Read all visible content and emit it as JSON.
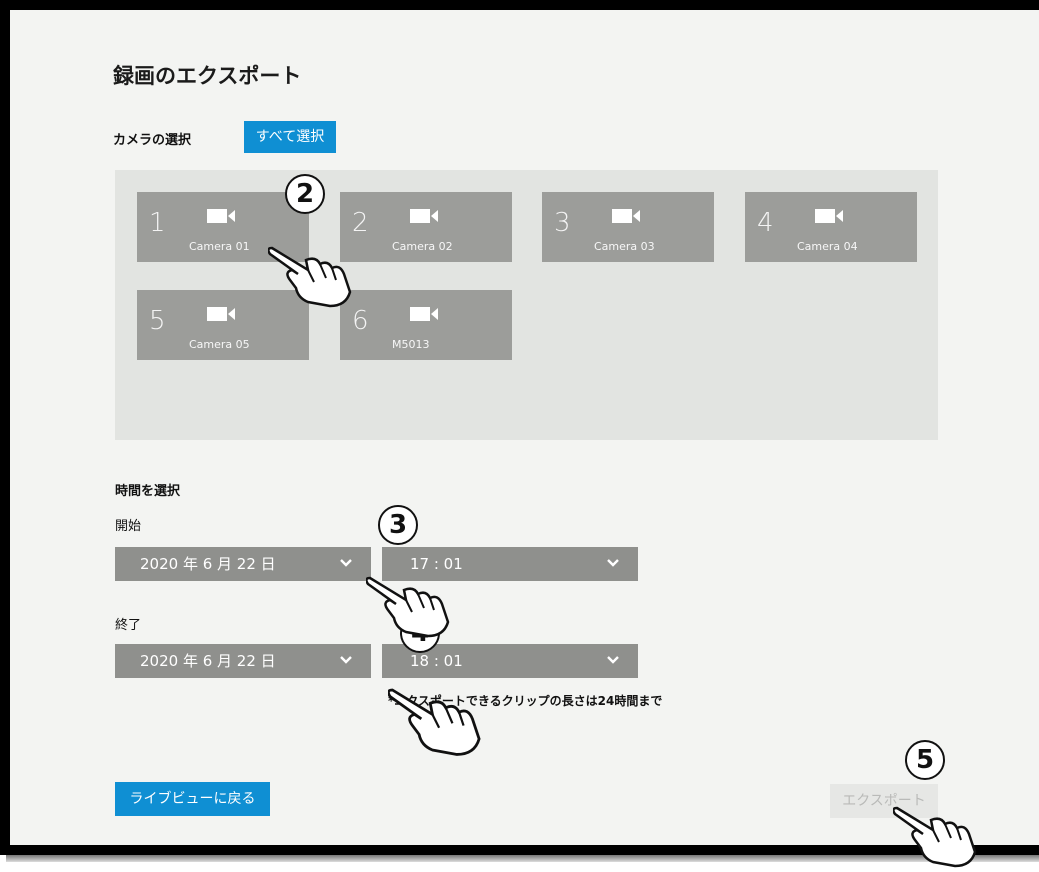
{
  "page": {
    "title": "録画のエクスポート",
    "camera_select_label": "カメラの選択",
    "select_all_label": "すべて選択",
    "time_select_label": "時間を選択",
    "start_label": "開始",
    "end_label": "終了",
    "note": "*エクスポートできるクリップの長さは24時間まで",
    "back_button_label": "ライブビューに戻る",
    "export_button_label": "エクスポート"
  },
  "cameras": [
    {
      "number": "1",
      "name": "Camera 01",
      "icon": "video-camera-icon"
    },
    {
      "number": "2",
      "name": "Camera 02",
      "icon": "video-camera-icon"
    },
    {
      "number": "3",
      "name": "Camera 03",
      "icon": "video-camera-icon"
    },
    {
      "number": "4",
      "name": "Camera 04",
      "icon": "video-camera-icon"
    },
    {
      "number": "5",
      "name": "Camera 05",
      "icon": "video-camera-icon"
    },
    {
      "number": "6",
      "name": "M5013",
      "icon": "video-camera-icon"
    }
  ],
  "start": {
    "date": "2020 年 6 月 22 日",
    "time": "17 : 01"
  },
  "end": {
    "date": "2020 年 6 月 22 日",
    "time": "18 : 01"
  },
  "steps": [
    "2",
    "3",
    "4",
    "5"
  ],
  "colors": {
    "accent": "#0f8fd3",
    "tile": "#9c9d9a",
    "select": "#8f908d",
    "camera_area": "#e2e4e1",
    "background": "#f3f4f2"
  }
}
